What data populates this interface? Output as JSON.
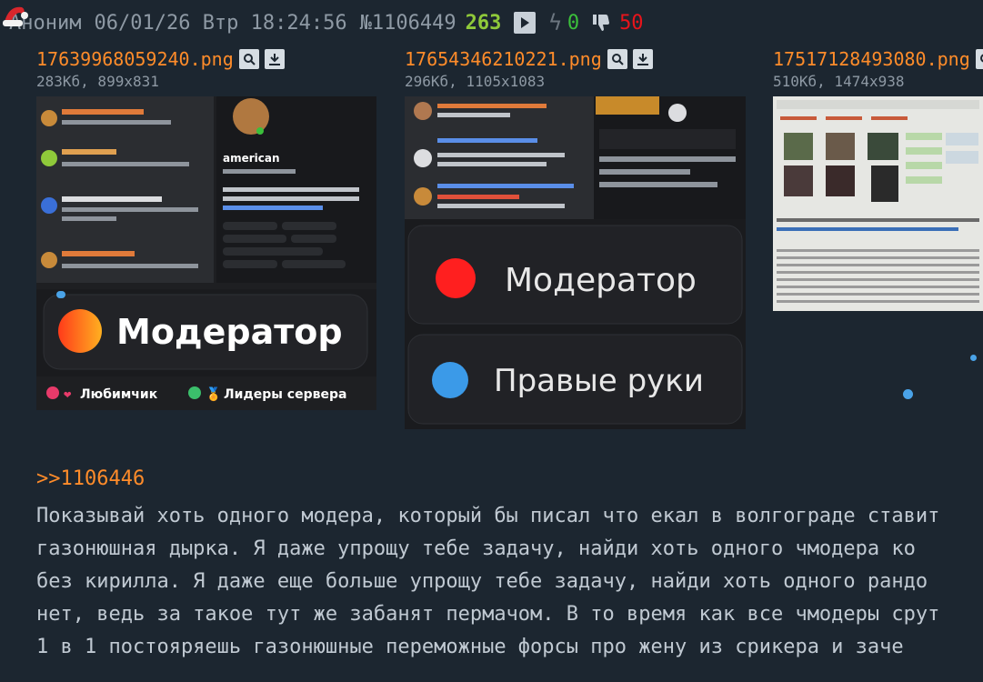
{
  "post": {
    "author": "Аноним",
    "date": "06/01/26 Втр 18:24:56",
    "number": "№1106449",
    "replies": "263",
    "likes": "0",
    "dislikes": "50"
  },
  "files": [
    {
      "name": "17639968059240.png",
      "meta": "283Кб, 899x831"
    },
    {
      "name": "17654346210221.png",
      "meta": "296Кб, 1105x1083"
    },
    {
      "name": "17517128493080.png",
      "meta": "510Кб, 1474x938"
    }
  ],
  "thumb1": {
    "profile_name": "american",
    "role": "Модератор",
    "tag_love": "Любимчик",
    "tag_leaders": "Лидеры сервера"
  },
  "thumb2": {
    "role1": "Модератор",
    "role2": "Правые руки"
  },
  "reply_link": ">>1106446",
  "text_lines": [
    "Показывай хоть одного модера, который бы писал что екал в волгограде ставит",
    "газонюшная дырка. Я даже упрощу тебе задачу, найди хоть одного чмодера ко",
    "без кирилла. Я даже еще больше упрощу тебе задачу, найди хоть одного рандо",
    "нет, ведь за такое тут же забанят пермачом. В то время как все чмодеры срут",
    "1 в 1 постояряешь газонюшные переможные форсы про жену из срикера и заче"
  ],
  "colors": {
    "background": "#1c2630",
    "link": "#ff8c2a",
    "replies": "#8fc93a",
    "likes": "#3bbf3b",
    "dislikes": "#e8141b"
  }
}
